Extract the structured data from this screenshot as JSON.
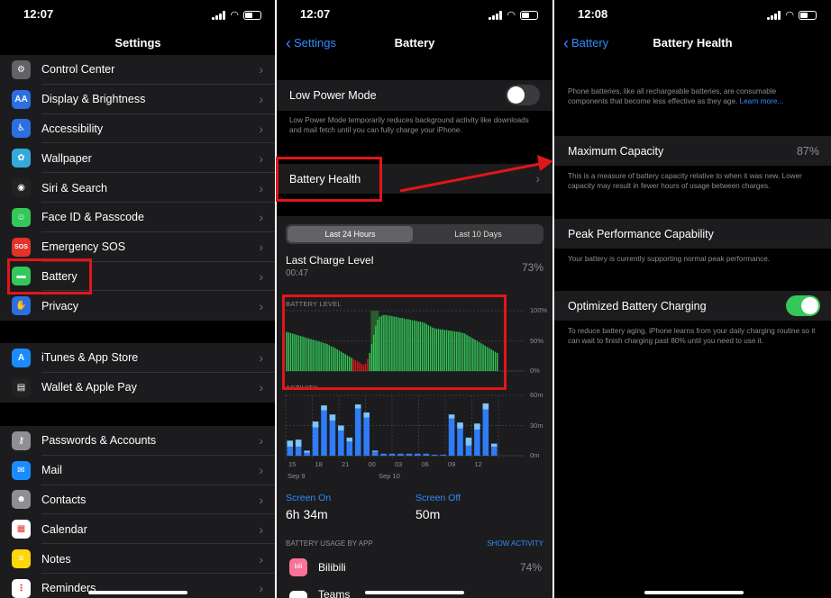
{
  "status": {
    "time_left": "12:07",
    "time_mid": "12:07",
    "time_right": "12:08"
  },
  "settings": {
    "title": "Settings",
    "group1": [
      {
        "label": "Control Center",
        "icon": "control-center-icon",
        "color": "#636366",
        "glyph": "⚙"
      },
      {
        "label": "Display & Brightness",
        "icon": "display-icon",
        "color": "#2c6fe0",
        "glyph": "AA"
      },
      {
        "label": "Accessibility",
        "icon": "accessibility-icon",
        "color": "#2c6fe0",
        "glyph": "♿"
      },
      {
        "label": "Wallpaper",
        "icon": "wallpaper-icon",
        "color": "#34aadc",
        "glyph": "✿"
      },
      {
        "label": "Siri & Search",
        "icon": "siri-icon",
        "color": "#222",
        "glyph": "◉"
      },
      {
        "label": "Face ID & Passcode",
        "icon": "face-id-icon",
        "color": "#34c759",
        "glyph": "☺"
      },
      {
        "label": "Emergency SOS",
        "icon": "sos-icon",
        "color": "#e5332a",
        "glyph": "SOS"
      },
      {
        "label": "Battery",
        "icon": "battery-icon",
        "color": "#34c759",
        "glyph": "▬"
      },
      {
        "label": "Privacy",
        "icon": "privacy-hand-icon",
        "color": "#2c6fe0",
        "glyph": "✋"
      }
    ],
    "group2": [
      {
        "label": "iTunes & App Store",
        "icon": "app-store-icon",
        "color": "#1a8cff",
        "glyph": "A"
      },
      {
        "label": "Wallet & Apple Pay",
        "icon": "wallet-icon",
        "color": "#222",
        "glyph": "▤"
      }
    ],
    "group3": [
      {
        "label": "Passwords & Accounts",
        "icon": "key-icon",
        "color": "#8e8e93",
        "glyph": "⚷"
      },
      {
        "label": "Mail",
        "icon": "mail-icon",
        "color": "#1a8cff",
        "glyph": "✉"
      },
      {
        "label": "Contacts",
        "icon": "contacts-icon",
        "color": "#8e8e93",
        "glyph": "☻"
      },
      {
        "label": "Calendar",
        "icon": "calendar-icon",
        "color": "#ffffff",
        "glyph": "▦"
      },
      {
        "label": "Notes",
        "icon": "notes-icon",
        "color": "#ffd60a",
        "glyph": "≡"
      },
      {
        "label": "Reminders",
        "icon": "reminders-icon",
        "color": "#ffffff",
        "glyph": "⋮"
      }
    ]
  },
  "battery": {
    "back": "Settings",
    "title": "Battery",
    "low_power_label": "Low Power Mode",
    "low_power_note": "Low Power Mode temporarily reduces background activity like downloads and mail fetch until you can fully charge your iPhone.",
    "health_label": "Battery Health",
    "seg_24": "Last 24 Hours",
    "seg_10": "Last 10 Days",
    "last_charge_label": "Last Charge Level",
    "last_charge_time": "00:47",
    "last_charge_value": "73%",
    "battery_level_label": "BATTERY LEVEL",
    "activity_label": "ACTIVITY",
    "level_ticks": [
      "100%",
      "50%",
      "0%"
    ],
    "activity_ticks": [
      "60m",
      "30m",
      "0m"
    ],
    "x_ticks": [
      "15",
      "18",
      "21",
      "00",
      "03",
      "06",
      "09",
      "12"
    ],
    "date_left": "Sep 9",
    "date_right": "Sep 10",
    "screen_on_label": "Screen On",
    "screen_on_value": "6h 34m",
    "screen_off_label": "Screen Off",
    "screen_off_value": "50m",
    "usage_label": "BATTERY USAGE BY APP",
    "show_activity": "SHOW ACTIVITY",
    "app1_name": "Bilibili",
    "app1_value": "74%",
    "app2_name": "Teams"
  },
  "chart_data": [
    {
      "type": "bar",
      "title": "BATTERY LEVEL",
      "ylim": [
        0,
        100
      ],
      "values": [
        65,
        64,
        63,
        62,
        61,
        60,
        59,
        58,
        57,
        56,
        55,
        54,
        53,
        52,
        51,
        50,
        49,
        48,
        47,
        46,
        45,
        43,
        41,
        40,
        38,
        36,
        34,
        32,
        30,
        28,
        26,
        24,
        22,
        20,
        18,
        16,
        14,
        12,
        10,
        12,
        20,
        30,
        45,
        60,
        75,
        85,
        90,
        92,
        93,
        93,
        92,
        92,
        91,
        90,
        90,
        89,
        88,
        88,
        87,
        86,
        86,
        85,
        84,
        84,
        83,
        82,
        82,
        81,
        80,
        78,
        76,
        74,
        72,
        71,
        70,
        70,
        69,
        69,
        68,
        68,
        67,
        67,
        66,
        66,
        65,
        65,
        64,
        63,
        62,
        60,
        58,
        56,
        54,
        52,
        50,
        48,
        46,
        44,
        42,
        40,
        38,
        36,
        34,
        32,
        30
      ],
      "charging_start": 42
    },
    {
      "type": "bar",
      "title": "ACTIVITY",
      "x": [
        "15",
        "18",
        "21",
        "00",
        "03",
        "06",
        "09",
        "12"
      ],
      "ylim": [
        0,
        60
      ],
      "series": [
        {
          "values": [
            9,
            9,
            3,
            28,
            45,
            35,
            25,
            14,
            47,
            38,
            4,
            2,
            2,
            2,
            2,
            2,
            2,
            1,
            1,
            37,
            27,
            10,
            26,
            46,
            9
          ]
        },
        {
          "values": [
            6,
            7,
            2,
            6,
            5,
            6,
            5,
            4,
            4,
            5,
            1,
            0,
            0,
            0,
            0,
            0,
            0,
            0,
            0,
            4,
            6,
            8,
            6,
            6,
            3
          ]
        }
      ]
    }
  ],
  "health": {
    "back": "Battery",
    "title": "Battery Health",
    "intro": "Phone batteries, like all rechargeable batteries, are consumable components that become less effective as they age.",
    "learn_more": "Learn more...",
    "max_cap_label": "Maximum Capacity",
    "max_cap_value": "87%",
    "max_cap_note": "This is a measure of battery capacity relative to when it was new. Lower capacity may result in fewer hours of usage between charges.",
    "peak_label": "Peak Performance Capability",
    "peak_note": "Your battery is currently supporting normal peak performance.",
    "optimized_label": "Optimized Battery Charging",
    "optimized_note": "To reduce battery aging, iPhone learns from your daily charging routine so it can wait to finish charging past 80% until you need to use it."
  },
  "colors": {
    "accent": "#2f8cff",
    "green": "#34c759",
    "red": "#e0161b"
  }
}
